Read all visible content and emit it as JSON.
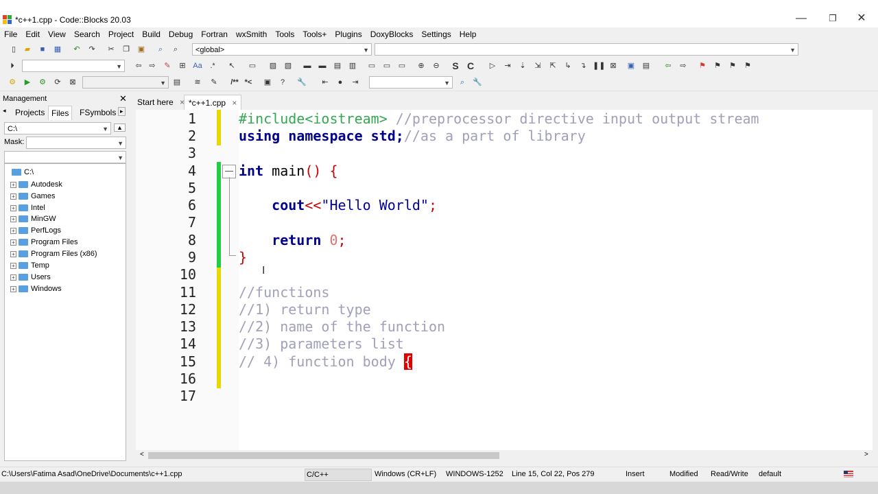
{
  "window": {
    "title": "*c++1.cpp - Code::Blocks 20.03",
    "controls": {
      "minimize": "—",
      "restore": "❐",
      "close": "✕"
    }
  },
  "menu": [
    "File",
    "Edit",
    "View",
    "Search",
    "Project",
    "Build",
    "Debug",
    "Fortran",
    "wxSmith",
    "Tools",
    "Tools+",
    "Plugins",
    "DoxyBlocks",
    "Settings",
    "Help"
  ],
  "toolbar": {
    "scope_combo": "<global>",
    "function_combo": "",
    "search_combo": ""
  },
  "management": {
    "title": "Management",
    "tabs": [
      "Projects",
      "Files",
      "FSymbols"
    ],
    "active_tab": "Files",
    "path_combo": "C:\\",
    "mask_label": "Mask:",
    "mask_value": "",
    "tree_root": "C:\\",
    "folders": [
      "Autodesk",
      "Games",
      "Intel",
      "MinGW",
      "PerfLogs",
      "Program Files",
      "Program Files (x86)",
      "Temp",
      "Users",
      "Windows"
    ]
  },
  "editor": {
    "tabs": [
      {
        "label": "Start here",
        "close": "×"
      },
      {
        "label": "*c++1.cpp",
        "close": "×"
      }
    ],
    "active_tab": "*c++1.cpp",
    "line_numbers": [
      "1",
      "2",
      "3",
      "4",
      "5",
      "6",
      "7",
      "8",
      "9",
      "10",
      "11",
      "12",
      "13",
      "14",
      "15",
      "16",
      "17"
    ],
    "lines": {
      "l1_pp": "#include<iostream>",
      "l1_cm": " //preprocessor directive input output stream",
      "l2_kw": "using namespace std;",
      "l2_cm": "//as a part of library",
      "l4_kw": "int",
      "l4_tx": " main",
      "l4_op": "() {",
      "l6_kw": "    cout",
      "l6_op": "<<",
      "l6_st": "\"Hello World\"",
      "l6_semi": ";",
      "l8_kw": "    return",
      "l8_num": " 0",
      "l8_semi": ";",
      "l9_op": "}",
      "l11": "//functions",
      "l12": "//1) return type",
      "l13": "//2) name of the function",
      "l14": "//3) parameters list",
      "l15": "// 4) function body ",
      "l15_brace": "{"
    }
  },
  "status": {
    "path": "C:\\Users\\Fatima Asad\\OneDrive\\Documents\\c++1.cpp",
    "language": "C/C++",
    "line_endings": "Windows (CR+LF)",
    "encoding": "WINDOWS-1252",
    "position": "Line 15, Col 22, Pos 279",
    "insert_mode": "Insert",
    "modified": "Modified",
    "access": "Read/Write",
    "profile": "default"
  },
  "colors": {
    "keyword": "#00008b",
    "preprocessor": "#32a852",
    "comment": "#a0a0b8",
    "string": "#0000a0",
    "operator": "#cc0000",
    "number": "#e07070",
    "change_saved": "#22cc44",
    "change_unsaved": "#e8d800"
  }
}
